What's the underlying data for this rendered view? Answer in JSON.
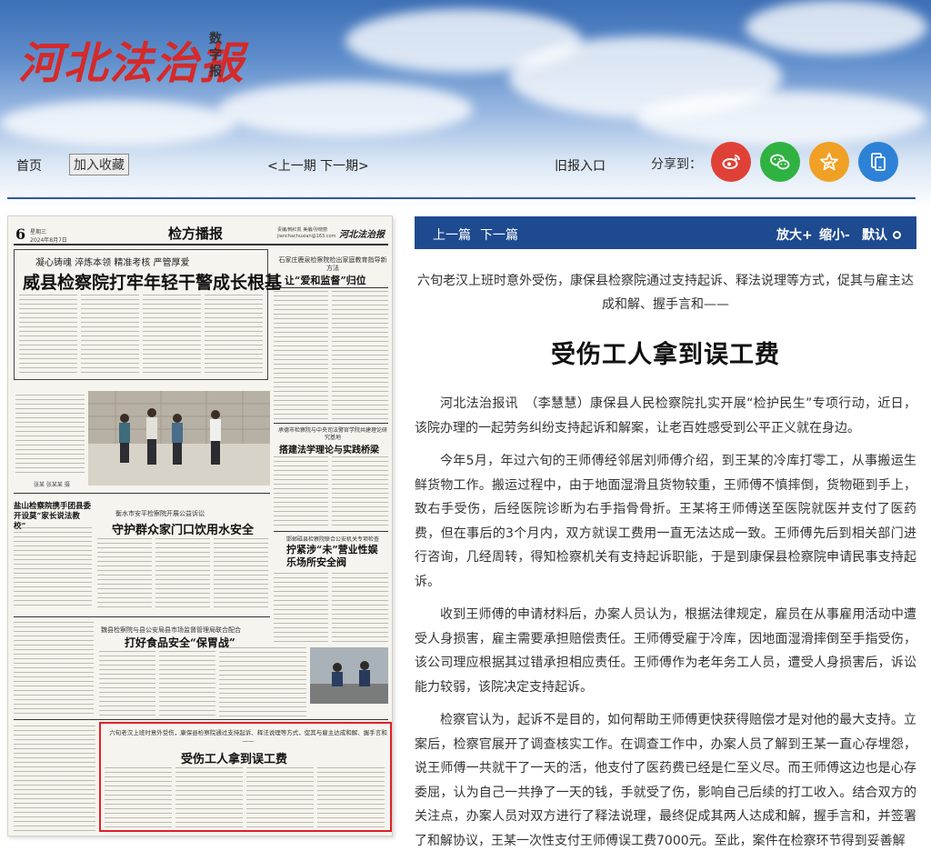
{
  "header": {
    "logo_text": "河北法治报",
    "logo_sub": "数字报"
  },
  "nav": {
    "home": "首页",
    "favorite": "加入收藏",
    "prev_issue": "<上一期",
    "next_issue": "下一期>",
    "archive": "旧报入口",
    "share_label": "分享到：",
    "share_items": [
      {
        "icon": "weibo-icon",
        "color": "#e04136"
      },
      {
        "icon": "wechat-icon",
        "color": "#2fb241"
      },
      {
        "icon": "qzone-star-icon",
        "color": "#f0a025"
      },
      {
        "icon": "mobile-icon",
        "color": "#2d82d6"
      }
    ]
  },
  "paper": {
    "page_no": "6",
    "weekday": "星期三",
    "date": "2024年8月7日",
    "section": "检方播报",
    "editor": "责编/韩红凯 美编/孙晓丽",
    "email": "jianchachuxian@163.com",
    "masthead": "河北法治报",
    "headline_main": "威县检察院打牢年轻干警成长根基",
    "headline_kicker": "凝心铸魂  淬炼本领  精准考核  严管厚爱",
    "right1_kicker": "石家庄鹿泉检察院检出家庭教育指导新方法",
    "right1_title": "让“爱和监督”归位",
    "right2_kicker": "承德市检察院与中央司法警官学院共建理论研究基地",
    "right2_title": "搭建法学理论与实践桥梁",
    "photo_caption": "张某  张某某  摄",
    "left_mid_title": "盐山检察院携手团县委开设莫“家长说法教校”",
    "mid_kicker": "衡水市安平检察院开展公益诉讼",
    "mid_title": "守护群众家门口饮用水安全",
    "right3_kicker": "邯郸磁县检察院联合公安机关专项检查",
    "right3_title": "拧紧涉“未”营业性娱乐场所安全阀",
    "bottom_kicker": "魏县检察院与县公安局县市场监督管理局联合配合",
    "bottom_title": "打好食品安全“保胃战”",
    "active_kicker": "六旬老汉上班时意外受伤，康保县检察院通过支持起诉、释法说理等方式，促其与雇主达成和解、握手言和——",
    "active_title": "受伤工人拿到误工费"
  },
  "article_bar": {
    "prev": "上一篇",
    "next": "下一篇",
    "zoom_in": "放大+",
    "zoom_out": "缩小-",
    "reset": "默认"
  },
  "article": {
    "subtitle": "六旬老汉上班时意外受伤，康保县检察院通过支持起诉、释法说理等方式，促其与雇主达成和解、握手言和——",
    "title": "受伤工人拿到误工费",
    "paragraphs": [
      "河北法治报讯　（李慧慧）康保县人民检察院扎实开展“检护民生”专项行动，近日，该院办理的一起劳务纠纷支持起诉和解案，让老百姓感受到公平正义就在身边。",
      "今年5月，年过六旬的王师傅经邻居刘师傅介绍，到王某的冷库打零工，从事搬运生鲜货物工作。搬运过程中，由于地面湿滑且货物较重，王师傅不慎摔倒，货物砸到手上，致右手受伤，后经医院诊断为右手指骨骨折。王某将王师傅送至医院就医并支付了医药费，但在事后的3个月内，双方就误工费用一直无法达成一致。王师傅先后到相关部门进行咨询，几经周转，得知检察机关有支持起诉职能，于是到康保县检察院申请民事支持起诉。",
      "收到王师傅的申请材料后，办案人员认为，根据法律规定，雇员在从事雇用活动中遭受人身损害，雇主需要承担赔偿责任。王师傅受雇于冷库，因地面湿滑摔倒至手指受伤，该公司理应根据其过错承担相应责任。王师傅作为老年务工人员，遭受人身损害后，诉讼能力较弱，该院决定支持起诉。",
      "检察官认为，起诉不是目的，如何帮助王师傅更快获得赔偿才是对他的最大支持。立案后，检察官展开了调查核实工作。在调查工作中，办案人员了解到王某一直心存埋怨，说王师傅一共就干了一天的活，他支付了医药费已经是仁至义尽。而王师傅这边也是心存委屈，认为自己一共挣了一天的钱，手就受了伤，影响自己后续的打工收入。结合双方的关注点，办案人员对双方进行了释法说理，最终促成其两人达成和解，握手言和，并签署了和解协议，王某一次性支付王师傅误工费7000元。至此，案件在检察环节得到妥善解"
    ]
  }
}
